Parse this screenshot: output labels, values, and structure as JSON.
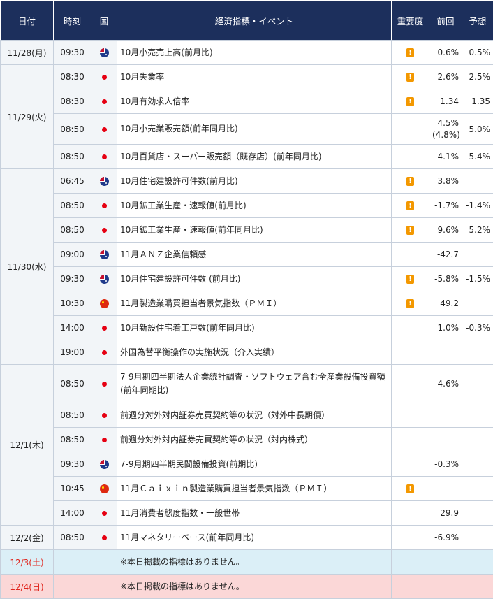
{
  "headers": {
    "date": "日付",
    "time": "時刻",
    "country": "国",
    "event": "経済指標・イベント",
    "importance": "重要度",
    "previous": "前回",
    "forecast": "予想"
  },
  "colors": {
    "header_bg": "#1c2f5c",
    "holiday_text": "#e0261e",
    "saturday_bg": "#dbeff7",
    "sunday_bg": "#fbd7d7",
    "importance_icon": "#f39800"
  },
  "icons": {
    "jp": "japan-flag-icon",
    "au": "australia-flag-icon",
    "cn": "china-flag-icon",
    "importance": "exclamation-icon"
  },
  "rows": [
    {
      "date": "11/28(月)",
      "time": "09:30",
      "country": "au",
      "event": "10月小売売上高(前月比)",
      "important": true,
      "prev": "0.6%",
      "forecast": "0.5%"
    },
    {
      "date": "11/29(火)",
      "time": "08:30",
      "country": "jp",
      "event": "10月失業率",
      "important": true,
      "prev": "2.6%",
      "forecast": "2.5%"
    },
    {
      "date": "",
      "time": "08:30",
      "country": "jp",
      "event": "10月有効求人倍率",
      "important": true,
      "prev": "1.34",
      "forecast": "1.35"
    },
    {
      "date": "",
      "time": "08:50",
      "country": "jp",
      "event": "10月小売業販売額(前年同月比)",
      "important": false,
      "prev": "4.5%",
      "prev_sub": "(4.8%)",
      "forecast": "5.0%"
    },
    {
      "date": "",
      "time": "08:50",
      "country": "jp",
      "event": "10月百貨店・スーパー販売額（既存店）(前年同月比)",
      "important": false,
      "prev": "4.1%",
      "forecast": "5.4%"
    },
    {
      "date": "11/30(水)",
      "time": "06:45",
      "country": "au",
      "event": "10月住宅建設許可件数(前月比)",
      "important": true,
      "prev": "3.8%",
      "forecast": ""
    },
    {
      "date": "",
      "time": "08:50",
      "country": "jp",
      "event": "10月鉱工業生産・速報値(前月比)",
      "important": true,
      "prev": "-1.7%",
      "forecast": "-1.4%"
    },
    {
      "date": "",
      "time": "08:50",
      "country": "jp",
      "event": "10月鉱工業生産・速報値(前年同月比)",
      "important": true,
      "prev": "9.6%",
      "forecast": "5.2%"
    },
    {
      "date": "",
      "time": "09:00",
      "country": "au",
      "event": "11月ＡＮＺ企業信頼感",
      "important": false,
      "prev": "-42.7",
      "forecast": ""
    },
    {
      "date": "",
      "time": "09:30",
      "country": "au",
      "event": "10月住宅建設許可件数 (前月比)",
      "important": true,
      "prev": "-5.8%",
      "forecast": "-1.5%"
    },
    {
      "date": "",
      "time": "10:30",
      "country": "cn",
      "event": "11月製造業購買担当者景気指数（ＰＭＩ）",
      "important": true,
      "prev": "49.2",
      "forecast": ""
    },
    {
      "date": "",
      "time": "14:00",
      "country": "jp",
      "event": "10月新設住宅着工戸数(前年同月比)",
      "important": false,
      "prev": "1.0%",
      "forecast": "-0.3%"
    },
    {
      "date": "",
      "time": "19:00",
      "country": "jp",
      "event": "外国為替平衡操作の実施状況（介入実績）",
      "important": false,
      "prev": "",
      "forecast": ""
    },
    {
      "date": "12/1(木)",
      "time": "08:50",
      "country": "jp",
      "event": "7-9月期四半期法人企業統計調査・ソフトウェア含む全産業設備投資額(前年同期比)",
      "important": false,
      "prev": "4.6%",
      "forecast": ""
    },
    {
      "date": "",
      "time": "08:50",
      "country": "jp",
      "event": "前週分対外対内証券売買契約等の状況（対外中長期債）",
      "important": false,
      "prev": "",
      "forecast": ""
    },
    {
      "date": "",
      "time": "08:50",
      "country": "jp",
      "event": "前週分対外対内証券売買契約等の状況（対内株式）",
      "important": false,
      "prev": "",
      "forecast": ""
    },
    {
      "date": "",
      "time": "09:30",
      "country": "au",
      "event": "7-9月期四半期民間設備投資(前期比)",
      "important": false,
      "prev": "-0.3%",
      "forecast": ""
    },
    {
      "date": "",
      "time": "10:45",
      "country": "cn",
      "event": "11月Ｃａｉｘｉｎ製造業購買担当者景気指数（ＰＭＩ）",
      "important": true,
      "prev": "",
      "forecast": ""
    },
    {
      "date": "",
      "time": "14:00",
      "country": "jp",
      "event": "11月消費者態度指数・一般世帯",
      "important": false,
      "prev": "29.9",
      "forecast": ""
    },
    {
      "date": "12/2(金)",
      "time": "08:50",
      "country": "jp",
      "event": "11月マネタリーベース(前年同月比)",
      "important": false,
      "prev": "-6.9%",
      "forecast": ""
    },
    {
      "date": "12/3(土)",
      "time": "",
      "country": "",
      "event": "※本日掲載の指標はありません。",
      "important": false,
      "prev": "",
      "forecast": "",
      "kind": "sat"
    },
    {
      "date": "12/4(日)",
      "time": "",
      "country": "",
      "event": "※本日掲載の指標はありません。",
      "important": false,
      "prev": "",
      "forecast": "",
      "kind": "sun"
    }
  ]
}
